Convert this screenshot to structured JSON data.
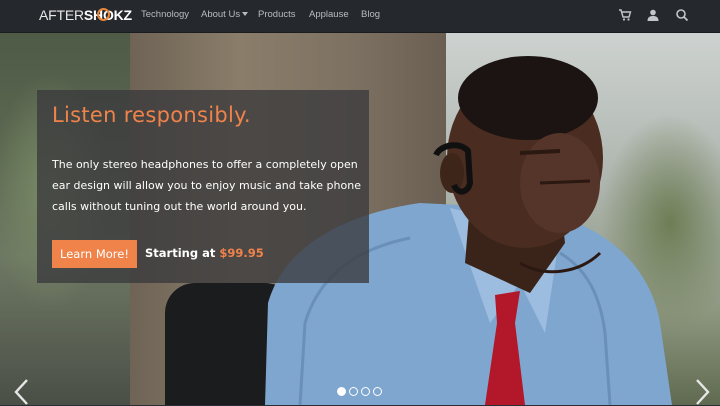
{
  "brand": {
    "logo_light": "AFTER",
    "logo_bold": "SHOKZ"
  },
  "nav": {
    "items": [
      {
        "label": "Technology"
      },
      {
        "label": "About Us"
      },
      {
        "label": "Products"
      },
      {
        "label": "Applause"
      },
      {
        "label": "Blog"
      }
    ],
    "icons": [
      "cart-icon",
      "user-icon",
      "search-icon"
    ]
  },
  "hero": {
    "headline": "Listen responsibly.",
    "body": "The only stereo headphones to offer a completely open ear design will allow you to enjoy music and take phone calls without tuning out the world around you.",
    "cta_label": "Learn More!",
    "price_prefix": "Starting at ",
    "price": "$99.95"
  },
  "carousel": {
    "slides": 4,
    "active": 1
  },
  "colors": {
    "accent": "#f0834a",
    "nav_bg": "#25282c",
    "panel_bg": "#3a3a3c"
  }
}
